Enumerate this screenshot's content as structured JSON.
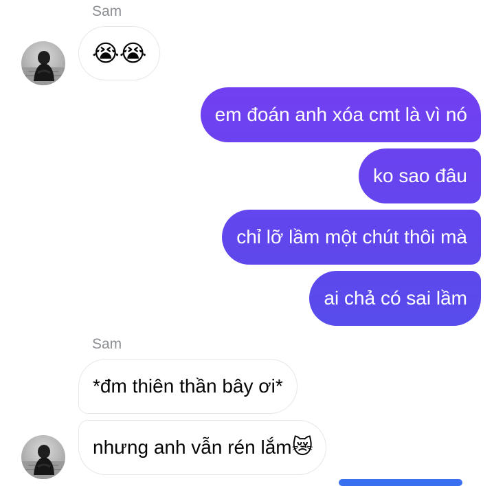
{
  "thread": {
    "groups": [
      {
        "sender": "Sam"
      },
      {
        "sender": "Sam"
      }
    ],
    "incoming": [
      {
        "text": "😭😭"
      },
      {
        "text": "*đm thiên thần bây ơi*"
      },
      {
        "text": "nhưng anh vẫn rén lắm",
        "emoji": "😿"
      }
    ],
    "outgoing": [
      {
        "text": "em đoán anh xóa cmt là vì nó"
      },
      {
        "text": "ko sao đâu"
      },
      {
        "text": "chỉ lỡ lầm một chút thôi mà"
      },
      {
        "text": "ai chả có sai lầm"
      }
    ]
  },
  "colors": {
    "outgoing_top": "#7c3cf3",
    "outgoing_bottom": "#4b55ea",
    "incoming_border": "#e4e6eb",
    "sender_name": "#8a8d91"
  }
}
